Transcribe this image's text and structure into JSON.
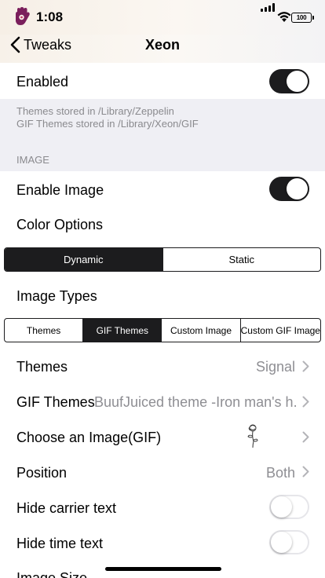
{
  "status_bar": {
    "time": "1:08",
    "battery": "100"
  },
  "nav": {
    "back_label": "Tweaks",
    "title": "Xeon"
  },
  "enabled_row": {
    "label": "Enabled",
    "toggle": true
  },
  "info": {
    "line1": "Themes stored in /Library/Zeppelin",
    "line2": "GIF Themes stored in /Library/Xeon/GIF"
  },
  "section": {
    "image_header": "IMAGE"
  },
  "enable_image_row": {
    "label": "Enable Image",
    "toggle": true
  },
  "color_options": {
    "label": "Color Options",
    "segments": [
      "Dynamic",
      "Static"
    ],
    "selected": "Dynamic"
  },
  "image_types": {
    "label": "Image Types",
    "segments": [
      "Themes",
      "GIF Themes",
      "Custom Image",
      "Custom GIF Image"
    ],
    "selected": "GIF Themes"
  },
  "themes_row": {
    "label": "Themes",
    "value": "Signal"
  },
  "gif_themes_row": {
    "label": "GIF Themes",
    "value": "BuufJuiced theme -Iron man's h..."
  },
  "choose_image_row": {
    "label": "Choose an Image(GIF)",
    "thumbnail_icon": "flower-sketch-icon"
  },
  "position_row": {
    "label": "Position",
    "value": "Both"
  },
  "hide_carrier_row": {
    "label": "Hide carrier text",
    "toggle": false
  },
  "hide_time_row": {
    "label": "Hide time text",
    "toggle": false
  },
  "image_size_row": {
    "label": "Image Size"
  },
  "colors": {
    "accent": "#1c1c1e",
    "secondary_text": "#8e8e93",
    "group_bg": "#efeff4"
  }
}
